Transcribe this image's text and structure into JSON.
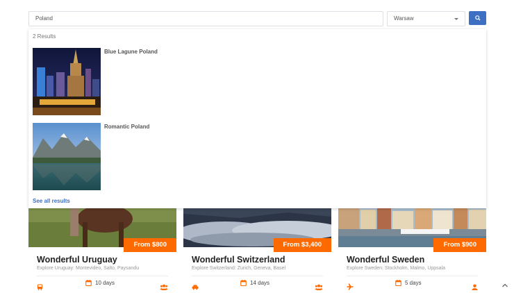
{
  "search": {
    "value": "Poland"
  },
  "city_select": {
    "selected": "Warsaw"
  },
  "results": {
    "count_label": "2 Results",
    "items": [
      {
        "title": "Blue Lagune Poland"
      },
      {
        "title": "Romantic Poland"
      }
    ],
    "see_all_label": "See all results"
  },
  "cards": [
    {
      "price": "From $800",
      "name": "Wonderful Uruguay",
      "subtitle": "Explore Uruguay: Montevideo, Salto, Paysandu",
      "duration": "10 days",
      "transport_icon": "bus-icon",
      "group_icon": "users-icon"
    },
    {
      "price": "From $3,400",
      "name": "Wonderful Switzerland",
      "subtitle": "Explore Switzerland: Zurich, Geneva, Basel",
      "duration": "14 days",
      "transport_icon": "car-icon",
      "group_icon": "users-icon"
    },
    {
      "price": "From $900",
      "name": "Wonderful Sweden",
      "subtitle": "Explore Sweden: Stockholm, Malmo, Uppsala",
      "duration": "5 days",
      "transport_icon": "plane-icon",
      "group_icon": "user-icon"
    }
  ],
  "colors": {
    "accent": "#3d6fc3",
    "price_badge": "#ff6a00",
    "icon_orange": "#ff6a00"
  }
}
